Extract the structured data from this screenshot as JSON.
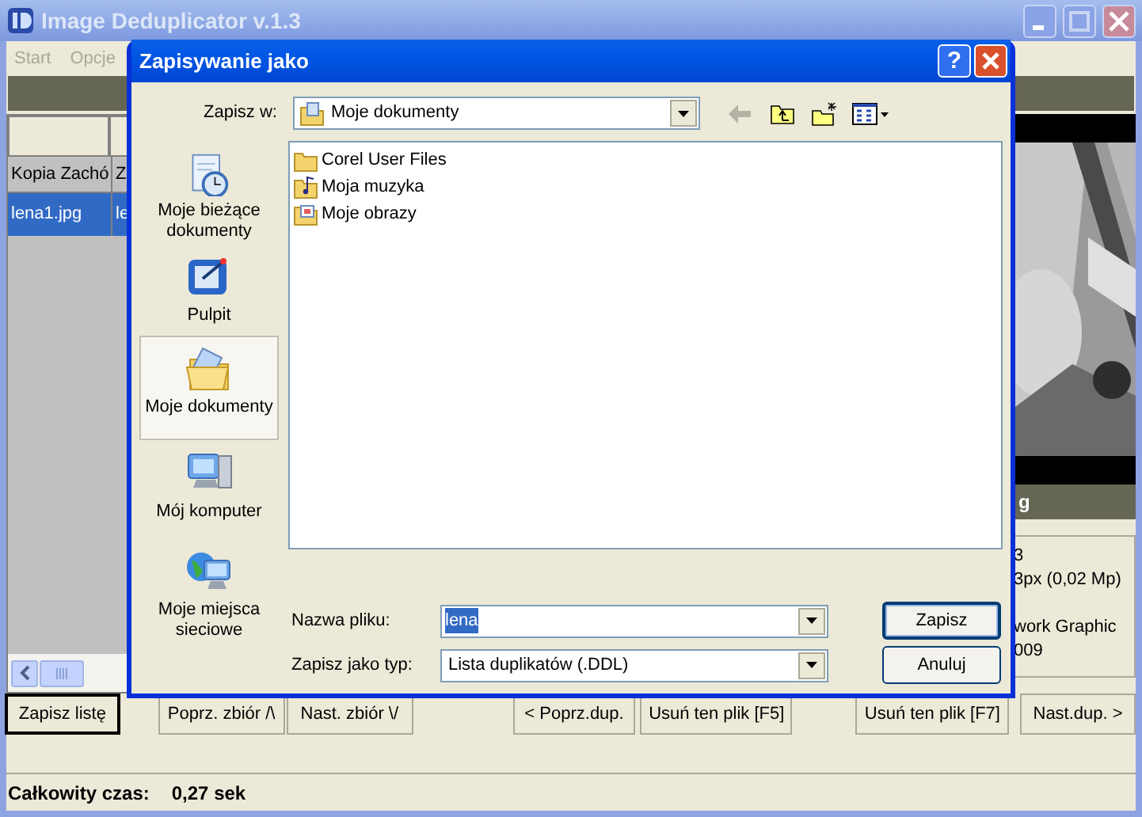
{
  "main_window": {
    "title": "Image Deduplicator v.1.3",
    "active": false,
    "menu": [
      {
        "label": "Start",
        "disabled": true
      },
      {
        "label": "Opcje",
        "disabled": true
      }
    ],
    "table": {
      "columns": [
        "Kopia Zachó",
        "Z"
      ],
      "rows": [
        {
          "cells": [
            "lena1.jpg",
            "le"
          ],
          "selected": true
        }
      ]
    },
    "preview": {
      "kind": "picture",
      "caption": "g"
    },
    "info": [
      "3",
      "3px (0,02 Mp)",
      "work Graphic",
      "009"
    ],
    "buttons": [
      {
        "label": "Zapisz listę",
        "default": true
      },
      {
        "label": "Poprz. zbiór /\\",
        "default": false
      },
      {
        "label": "Nast. zbiór \\/",
        "default": false
      },
      {
        "label": "< Poprz.dup.",
        "default": false
      },
      {
        "label": "Usuń ten plik [F5]",
        "default": false
      },
      {
        "label": "Usuń ten plik [F7]",
        "default": false
      },
      {
        "label": "Nast.dup. >",
        "default": false
      }
    ],
    "status_bar": {
      "label": "Całkowity czas:",
      "value": "0,27 sek"
    }
  },
  "dialog": {
    "title": "Zapisywanie jako",
    "help_button": "?",
    "save_in": {
      "label": "Zapisz w:",
      "value": "Moje dokumenty"
    },
    "places": [
      {
        "label": "Moje bieżące dokumenty",
        "kind": "recent",
        "selected": false
      },
      {
        "label": "Pulpit",
        "kind": "desktop",
        "selected": false
      },
      {
        "label": "Moje dokumenty",
        "kind": "documents",
        "selected": true
      },
      {
        "label": "Mój komputer",
        "kind": "computer",
        "selected": false
      },
      {
        "label": "Moje miejsca sieciowe",
        "kind": "network",
        "selected": false
      }
    ],
    "files": [
      {
        "name": "Corel User Files",
        "kind": "folder"
      },
      {
        "name": "Moja muzyka",
        "kind": "music"
      },
      {
        "name": "Moje obrazy",
        "kind": "pictures"
      }
    ],
    "file_name": {
      "label": "Nazwa pliku:",
      "value": "lena"
    },
    "file_type": {
      "label": "Zapisz jako typ:",
      "value": "Lista duplikatów (.DDL)"
    },
    "buttons": [
      {
        "label": "Zapisz",
        "default": true
      },
      {
        "label": "Anuluj",
        "default": false
      }
    ]
  }
}
